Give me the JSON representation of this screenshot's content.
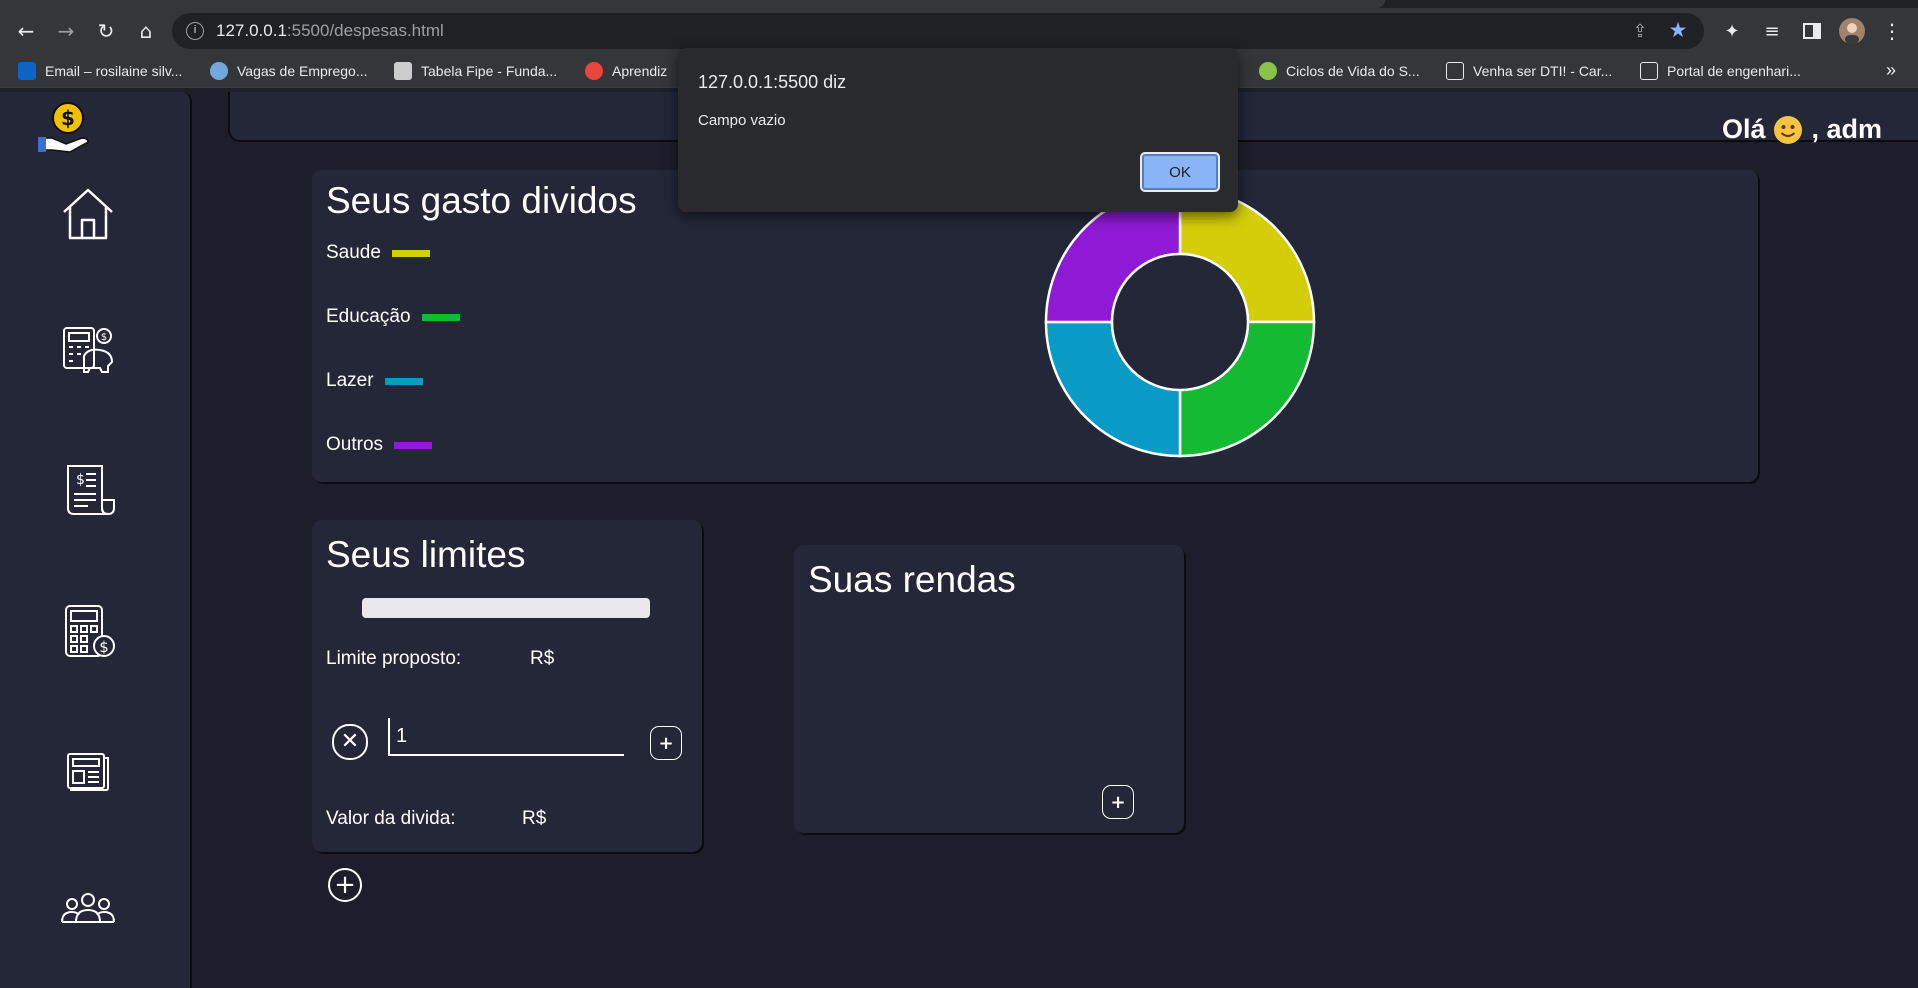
{
  "browser": {
    "url_host": "127.0.0.1",
    "url_path": ":5500/despesas.html",
    "bookmarks": [
      {
        "label": "Email – rosilaine silv...",
        "color": "#0a66c2"
      },
      {
        "label": "Vagas de Emprego...",
        "color": "#6fa8dc"
      },
      {
        "label": "Tabela Fipe - Funda...",
        "color": "#cccccc"
      },
      {
        "label": "Aprendiz",
        "color": "#e8453c"
      },
      {
        "label": "Ciclos de Vida do S...",
        "color": "#8bc34a"
      },
      {
        "label": "Venha ser DTI! - Car...",
        "color": "#222222"
      },
      {
        "label": "Portal de engenhari...",
        "color": "#222222"
      }
    ],
    "more_label": "»"
  },
  "topbar": {
    "greeting": "Olá",
    "username": ", adm"
  },
  "sidebar": {
    "items": [
      {
        "icon": "money-hand-icon"
      },
      {
        "icon": "home-icon"
      },
      {
        "icon": "calculator-piggy-icon"
      },
      {
        "icon": "receipt-icon"
      },
      {
        "icon": "calculator-coin-icon"
      },
      {
        "icon": "newspaper-icon"
      },
      {
        "icon": "people-icon"
      }
    ]
  },
  "expenses_card": {
    "title": "Seus gasto dividos",
    "legend": [
      {
        "label": "Saude",
        "color": "#d4cd0a"
      },
      {
        "label": "Educação",
        "color": "#14bb32"
      },
      {
        "label": "Lazer",
        "color": "#0a9ac6"
      },
      {
        "label": "Outros",
        "color": "#8f1ad6"
      }
    ]
  },
  "chart_data": {
    "type": "pie",
    "categories": [
      "Saude",
      "Educação",
      "Lazer",
      "Outros"
    ],
    "values": [
      25,
      25,
      25,
      25
    ],
    "colors": [
      "#d4cd0a",
      "#14bb32",
      "#0a9ac6",
      "#8f1ad6"
    ],
    "donut": true,
    "title": ""
  },
  "limits_card": {
    "title": "Seus limites",
    "proposed_label": "Limite proposto:",
    "proposed_value": "R$",
    "progress_fraction": 0,
    "input_value": "1",
    "debt_label": "Valor da divida:",
    "debt_value": "R$",
    "clear_symbol": "✕",
    "add_symbol": "+"
  },
  "income_card": {
    "title": "Suas rendas",
    "add_symbol": "+"
  },
  "dialog": {
    "title": "127.0.0.1:5500 diz",
    "message": "Campo vazio",
    "ok_label": "OK"
  }
}
